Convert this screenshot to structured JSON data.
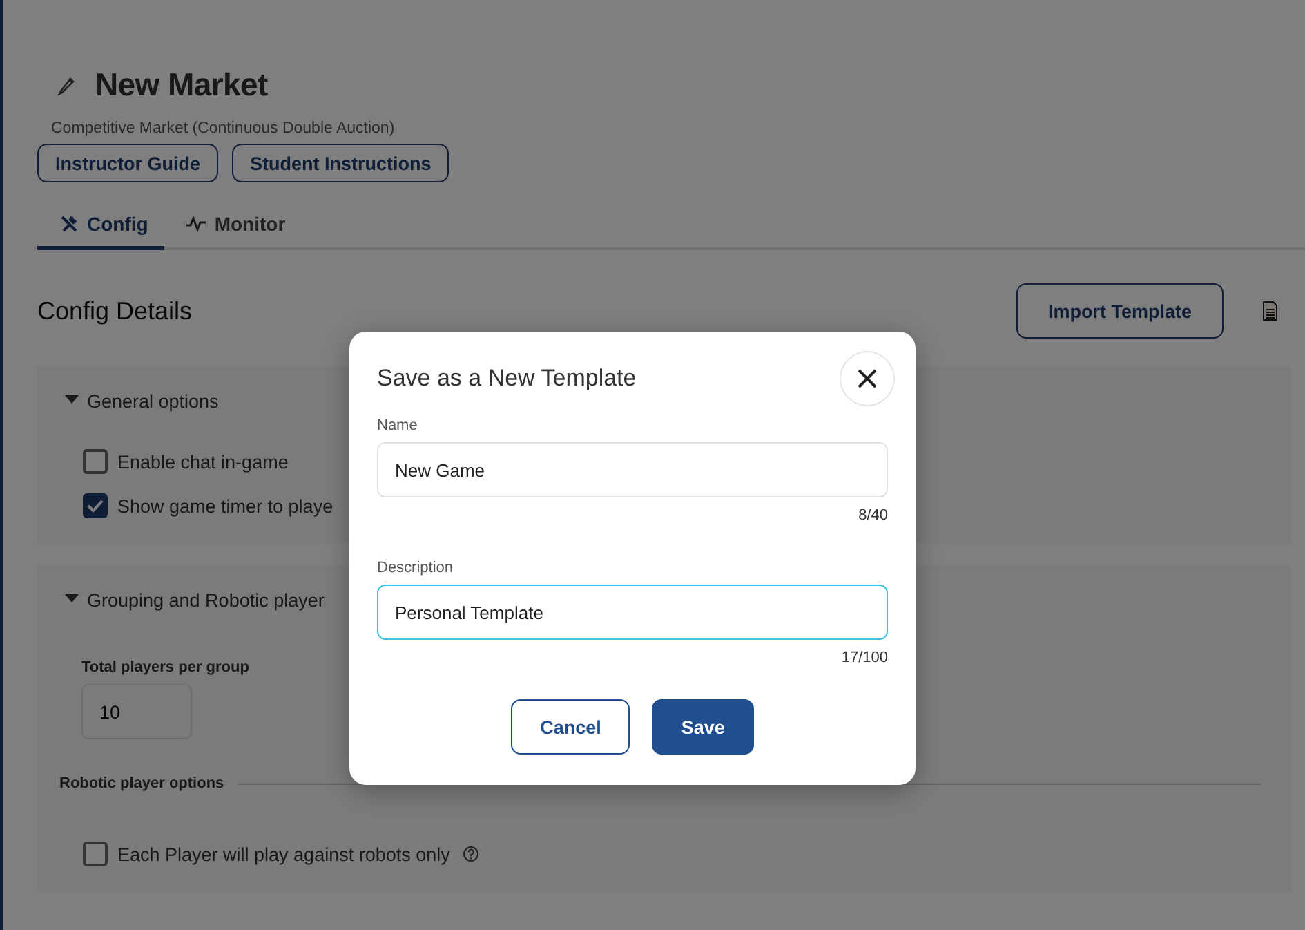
{
  "page": {
    "title": "New Market",
    "subtitle": "Competitive Market (Continuous Double Auction)",
    "guide_buttons": [
      "Instructor Guide",
      "Student Instructions"
    ]
  },
  "tabs": [
    {
      "label": "Config",
      "selected": true
    },
    {
      "label": "Monitor",
      "selected": false
    }
  ],
  "config": {
    "heading": "Config Details",
    "import_button": "Import Template",
    "sections": [
      {
        "title": "General options",
        "expanded": true,
        "items": [
          {
            "kind": "checkbox",
            "label": "Enable chat in-game",
            "checked": false
          },
          {
            "kind": "checkbox",
            "label": "Show game timer to playe",
            "checked": true
          }
        ]
      },
      {
        "title": "Grouping and Robotic player",
        "expanded": true,
        "items": [
          {
            "kind": "number",
            "label": "Total players per group",
            "value": "10"
          },
          {
            "kind": "subheading",
            "label": "Robotic player options"
          },
          {
            "kind": "checkbox",
            "label": "Each Player will play against robots only",
            "checked": false,
            "help": true
          }
        ]
      }
    ]
  },
  "dialog": {
    "title": "Save as a New Template",
    "fields": [
      {
        "label": "Name",
        "value": "New Game",
        "counter": "8/40",
        "focused": false
      },
      {
        "label": "Description",
        "value": "Personal Template",
        "counter": "17/100",
        "focused": true
      }
    ],
    "buttons": [
      {
        "label": "Cancel",
        "kind": "secondary"
      },
      {
        "label": "Save",
        "kind": "primary"
      }
    ]
  }
}
